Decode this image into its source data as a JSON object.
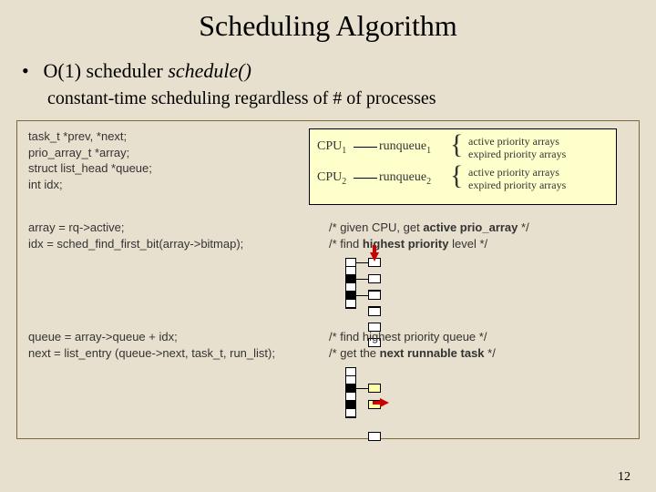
{
  "title": "Scheduling Algorithm",
  "bullet": {
    "prefix": "O(1) scheduler ",
    "func": "schedule()"
  },
  "sub": "constant-time scheduling regardless of  # of processes",
  "decl": [
    "task_t *prev, *next;",
    "prio_array_t *array;",
    "struct list_head *queue;",
    "int idx;"
  ],
  "cpu": {
    "rows": [
      {
        "cpu": "CPU",
        "cpu_sub": "1",
        "rq": "runqueue",
        "rq_sub": "1"
      },
      {
        "cpu": "CPU",
        "cpu_sub": "2",
        "rq": "runqueue",
        "rq_sub": "2"
      }
    ],
    "arr_active": "active   priority arrays",
    "arr_expired": "expired priority arrays"
  },
  "block2": {
    "l1": "array = rq->active;",
    "l2": "idx = sched_find_first_bit(array->bitmap);",
    "c1a": "/* given CPU, get ",
    "c1b": "active prio_array",
    "c1c": " */",
    "c2a": "/* find ",
    "c2b": "highest priority",
    "c2c": " level */"
  },
  "block3": {
    "l1": "queue = array->queue + idx;",
    "l2": "next = list_entry (queue->next, task_t, run_list);",
    "c1": "/* find highest priority queue */",
    "c2a": "/* get the ",
    "c2b": "next runnable task",
    "c2c": " */"
  },
  "page": "12"
}
